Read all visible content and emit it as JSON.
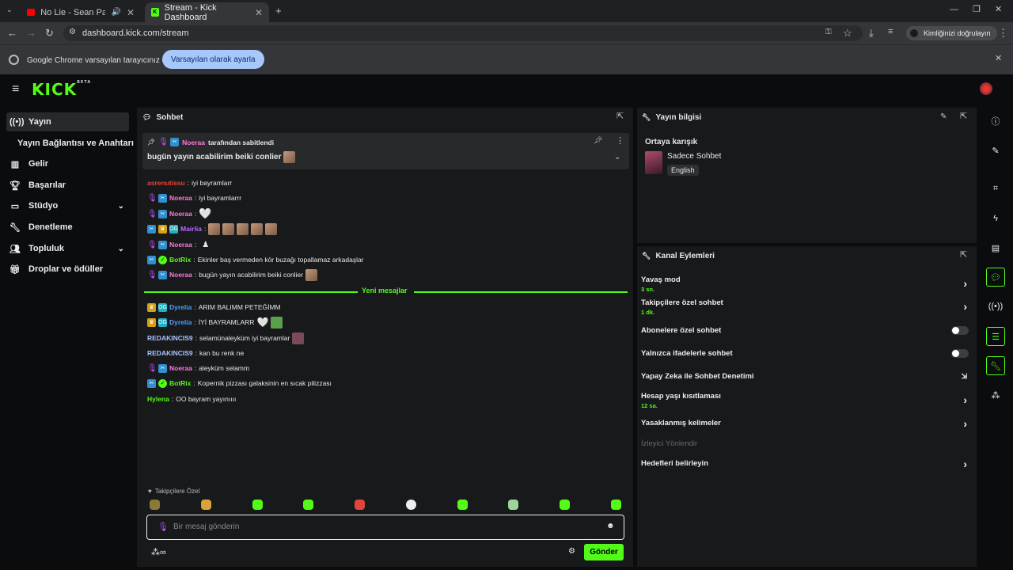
{
  "browser": {
    "tabs": [
      {
        "title": "No Lie - Sean Paul, Jaymes"
      },
      {
        "title": "Stream - Kick Dashboard"
      }
    ],
    "url": "dashboard.kick.com/stream",
    "profile_button": "Kimliğinizi doğrulayın",
    "infobar_text": "Google Chrome varsayılan tarayıcınız değil",
    "infobar_button": "Varsayılan olarak ayarla"
  },
  "brand": {
    "logo": "KICK",
    "beta": "BETA",
    "accent": "#53fc18"
  },
  "sidebar": {
    "items": [
      {
        "label": "Yayın",
        "icon": "broadcast-icon"
      },
      {
        "label": "Yayın Bağlantısı ve Anahtarı"
      },
      {
        "label": "Gelir",
        "icon": "chart-icon"
      },
      {
        "label": "Başarılar",
        "icon": "trophy-icon"
      },
      {
        "label": "Stüdyo",
        "icon": "studio-icon"
      },
      {
        "label": "Denetleme",
        "icon": "wrench-icon"
      },
      {
        "label": "Topluluk",
        "icon": "people-icon"
      },
      {
        "label": "Droplar ve ödüller",
        "icon": "gift-icon"
      }
    ]
  },
  "chat": {
    "title": "Sohbet",
    "pinned": {
      "by": "Noeraa",
      "by_suffix": "tarafından sabitlendi",
      "text": "bugün yayın acabilirim beiki conlier"
    },
    "messages_before": [
      {
        "user": "asrenutissu",
        "color": "#e0463a",
        "text": "iyi bayramlarr"
      },
      {
        "user": "Noeraa",
        "color": "#ff7ad9",
        "text": "iyi bayramlarrr"
      },
      {
        "user": "Noeraa",
        "color": "#ff7ad9",
        "text": ""
      },
      {
        "user": "Mairlia",
        "color": "#b36cff",
        "text": ""
      },
      {
        "user": "Noeraa",
        "color": "#ff7ad9",
        "text": ""
      },
      {
        "user": "BotRix",
        "color": "#53fc18",
        "text": "Ekinler baş vermeden kör buzağı topallamaz arkadaşlar"
      },
      {
        "user": "Noeraa",
        "color": "#ff7ad9",
        "text": "bugün yayın acabilirim beiki conlier"
      }
    ],
    "new_messages_label": "Yeni mesajlar",
    "messages_after": [
      {
        "user": "Dyrelia",
        "color": "#4aa3ff",
        "text": "ARIM BALIMM PETEĞİMM"
      },
      {
        "user": "Dyrelia",
        "color": "#4aa3ff",
        "text": "İYİ BAYRAMLARR"
      },
      {
        "user": "REDAKINCIS9",
        "color": "#a9c3ff",
        "text": "selamünaleyküm iyi bayramlar"
      },
      {
        "user": "REDAKINCIS9",
        "color": "#a9c3ff",
        "text": "kan bu renk ne"
      },
      {
        "user": "Noeraa",
        "color": "#ff7ad9",
        "text": "aleyküm selamm"
      },
      {
        "user": "BotRix",
        "color": "#53fc18",
        "text": "Kopernik pizzası galaksinin en sıcak pilizzası"
      },
      {
        "user": "Hylena",
        "color": "#53fc18",
        "text": "OO bayram yayınıııı"
      }
    ],
    "followers_only": "Takipçilere Özel",
    "input_placeholder": "Bir mesaj gönderin",
    "send_label": "Gönder"
  },
  "stream_info": {
    "title": "Yayın bilgisi",
    "stream_title": "Ortaya karışık",
    "category": "Sadece Sohbet",
    "language": "English"
  },
  "channel_actions": {
    "title": "Kanal Eylemleri",
    "slow_mode": {
      "label": "Yavaş mod",
      "value": "3 sn."
    },
    "followers_chat": {
      "label": "Takipçilere özel sohbet",
      "value": "1 dk."
    },
    "subscribers_chat": {
      "label": "Abonelere özel sohbet"
    },
    "emotes_chat": {
      "label": "Yalnızca ifadelerle sohbet"
    },
    "ai_moderation": {
      "label": "Yapay Zeka ile Sohbet Denetimi"
    },
    "account_age": {
      "label": "Hesap yaşı kısıtlaması",
      "value": "12 sa."
    },
    "banned_words": {
      "label": "Yasaklanmış kelimeler"
    },
    "viewer_redirect": {
      "label": "İzleyici Yönlendir"
    },
    "goals": {
      "label": "Hedefleri belirleyin"
    }
  }
}
